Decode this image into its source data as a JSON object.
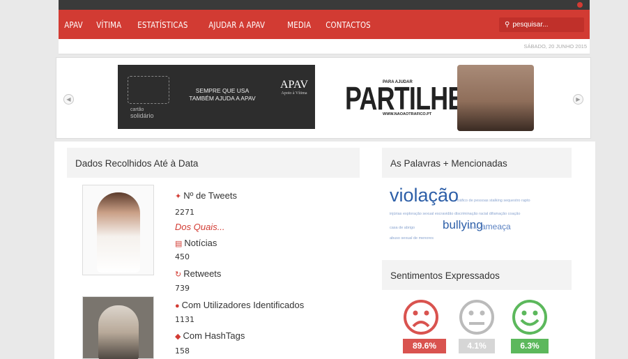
{
  "nav": {
    "items": [
      "APAV",
      "VÍTIMA",
      "ESTATÍSTICAS",
      "AJUDAR A APAV",
      "MEDIA",
      "CONTACTOS"
    ],
    "search_placeholder": "pesquisar..."
  },
  "date": "SÁBADO, 20 JUNHO 2015",
  "slider": {
    "banner1": {
      "logo_text_top": "cartão",
      "logo_text_bottom": "solidário",
      "message_line1": "SEMPRE QUE USA",
      "message_line2": "TAMBÉM AJUDA A APAV",
      "brand": "APAV",
      "brand_sub": "Apoio à Vítima"
    },
    "banner2": {
      "subtitle": "PARA AJUDAR",
      "title": "PARTILHE",
      "url": "WWW.NAOAOTRAFICO.PT"
    }
  },
  "stats_panel": {
    "title": "Dados Recolhidos Até à Data",
    "tweets_label": "Nº de Tweets",
    "tweets_value": "2271",
    "of_which": "Dos Quais...",
    "news_label": "Notícias",
    "news_value": "450",
    "retweets_label": "Retweets",
    "retweets_value": "739",
    "users_label": "Com Utilizadores Identificados",
    "users_value": "1131",
    "hashtags_label": "Com HashTags",
    "hashtags_value": "158"
  },
  "words_panel": {
    "title": "As Palavras + Mencionadas",
    "main_word": "violação",
    "words_line1": "tráfico de pessoas stalking sequestro rapto",
    "words_line2": "injúrias exploração sexual escravidão discriminação racial difamação coação",
    "word_small_a": "casa de abrigo",
    "word_bullying": "bullying",
    "word_small_b": "apav",
    "word_ameaca": "ameaça",
    "words_line4": "abuso sexual de menores"
  },
  "sentiment_panel": {
    "title": "Sentimentos Expressados",
    "negative": "89.6%",
    "neutral": "4.1%",
    "positive": "6.3%",
    "colors": {
      "negative": "#d9534f",
      "neutral": "#c8c8c8",
      "positive": "#5cb85c"
    }
  },
  "icons": {
    "pin": "pin-icon",
    "news": "newspaper-icon",
    "retweet": "retweet-icon",
    "user": "user-icon",
    "tag": "tag-icon",
    "search": "search-icon"
  }
}
